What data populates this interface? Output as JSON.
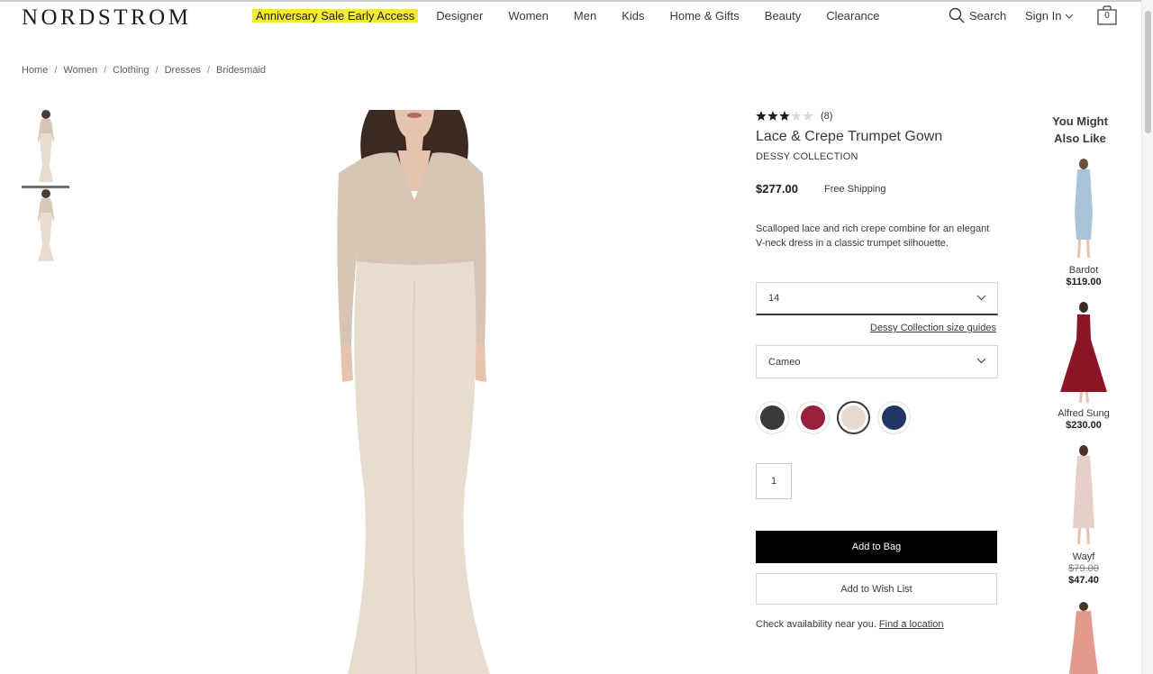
{
  "header": {
    "logo": "NORDSTROM",
    "nav": [
      "Anniversary Sale Early Access",
      "Designer",
      "Women",
      "Men",
      "Kids",
      "Home & Gifts",
      "Beauty",
      "Clearance"
    ],
    "search_label": "Search",
    "signin_label": "Sign In",
    "bag_count": "0"
  },
  "breadcrumb": [
    "Home",
    "Women",
    "Clothing",
    "Dresses",
    "Bridesmaid"
  ],
  "product": {
    "rating": 3,
    "rating_max": 5,
    "review_count": "(8)",
    "title": "Lace & Crepe Trumpet Gown",
    "brand": "DESSY COLLECTION",
    "price": "$277.00",
    "shipping": "Free Shipping",
    "description": "Scalloped lace and rich crepe combine for an elegant V-neck dress in a classic trumpet silhouette.",
    "size_value": "14",
    "size_guide_link": "Dessy Collection size guides",
    "color_value": "Cameo",
    "swatches": [
      {
        "name": "black",
        "color": "#3a3a3a",
        "selected": false
      },
      {
        "name": "burgundy",
        "color": "#9c1f3a",
        "selected": false
      },
      {
        "name": "cameo",
        "color": "#e7d9cd",
        "selected": true
      },
      {
        "name": "navy",
        "color": "#1f3762",
        "selected": false
      }
    ],
    "quantity": "1",
    "add_to_bag": "Add to Bag",
    "add_to_wishlist": "Add to Wish List",
    "availability_text": "Check availability near you.",
    "find_location": "Find a location"
  },
  "recommendations": {
    "title": "You Might Also Like",
    "items": [
      {
        "name": "Bardot",
        "price": "$119.00",
        "color": "#a9c3d8"
      },
      {
        "name": "Alfred Sung",
        "price": "$230.00",
        "color": "#8a1526"
      },
      {
        "name": "Wayf",
        "old_price": "$79.00",
        "price": "$47.40",
        "color": "#e6cfc6"
      },
      {
        "name": "",
        "price": "",
        "color": "#e29a8e"
      }
    ]
  },
  "colors": {
    "promo_highlight": "#f5e83a",
    "gown": "#e8dccf",
    "lace": "#d6c4b4",
    "primary_button": "#000000"
  }
}
